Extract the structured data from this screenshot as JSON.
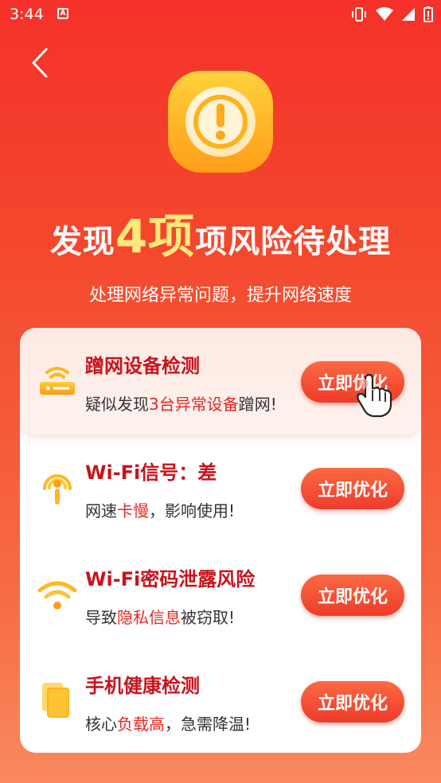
{
  "status_bar": {
    "time": "3:44",
    "app_badge": "A"
  },
  "header": {
    "title_prefix": "发现",
    "title_count": "4项",
    "title_suffix": "项风险待处理",
    "subtitle": "处理网络异常问题，提升网络速度"
  },
  "items": [
    {
      "title": "蹭网设备检测",
      "desc_before": "疑似发现",
      "desc_highlight": "3台异常设备",
      "desc_after": "蹭网!",
      "button": "立即优化",
      "icon": "router-icon"
    },
    {
      "title": "Wi-Fi信号：差",
      "desc_before": "网速",
      "desc_highlight": "卡慢",
      "desc_after": "，影响使用!",
      "button": "立即优化",
      "icon": "signal-broadcast-icon"
    },
    {
      "title": "Wi-Fi密码泄露风险",
      "desc_before": "导致",
      "desc_highlight": "隐私信息",
      "desc_after": "被窃取!",
      "button": "立即优化",
      "icon": "wifi-icon"
    },
    {
      "title": "手机健康检测",
      "desc_before": "核心",
      "desc_highlight": "负载高",
      "desc_after": "，急需降温!",
      "button": "立即优化",
      "icon": "phone-cards-icon"
    }
  ],
  "colors": {
    "background_top": "#f5312a",
    "background_bottom": "#f98a5e",
    "accent_yellow": "#ffe97a",
    "title_red": "#c8131c",
    "highlight_red": "#e62824",
    "button": "#ef3b2b"
  }
}
